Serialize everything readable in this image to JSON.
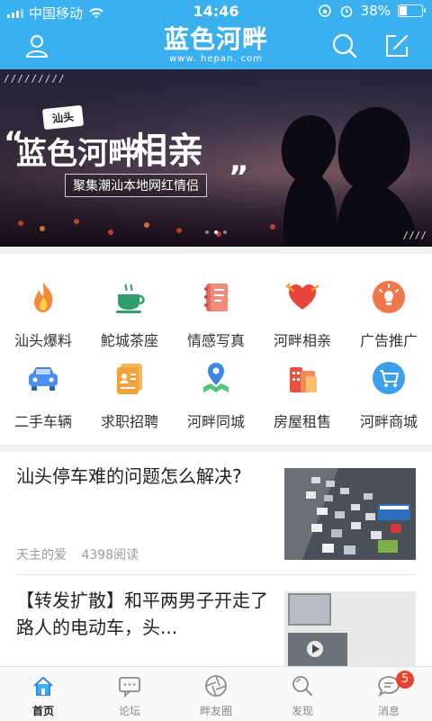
{
  "status_bar": {
    "carrier": "中国移动",
    "time": "14:46",
    "battery": "38%",
    "battery_level": 0.38
  },
  "header": {
    "logo_text": "蓝色河畔",
    "logo_domain": "www. hepan. com"
  },
  "banner": {
    "tag": "汕头",
    "title_part1": "蓝色河畔",
    "title_part2": "相亲",
    "subtitle": "聚集潮汕本地网红情侣",
    "slide_count": 3,
    "active_slide": 1
  },
  "categories": [
    {
      "label": "汕头爆料",
      "icon": "fire-icon",
      "color": "#f6883a"
    },
    {
      "label": "鮀城茶座",
      "icon": "tea-cup-icon",
      "color": "#2e9e6a"
    },
    {
      "label": "情感写真",
      "icon": "notebook-icon",
      "color": "#e8675a"
    },
    {
      "label": "河畔相亲",
      "icon": "heart-icon",
      "color": "#e8443a"
    },
    {
      "label": "广告推广",
      "icon": "lightbulb-icon",
      "color": "#f1774a"
    },
    {
      "label": "二手车辆",
      "icon": "car-icon",
      "color": "#3e7fdf"
    },
    {
      "label": "求职招聘",
      "icon": "id-card-icon",
      "color": "#f2a23a"
    },
    {
      "label": "河畔同城",
      "icon": "map-pin-icon",
      "color": "#3a86e0"
    },
    {
      "label": "房屋租售",
      "icon": "building-icon",
      "color": "#e8523e"
    },
    {
      "label": "河畔商城",
      "icon": "shopping-cart-icon",
      "color": "#3aa0ec"
    }
  ],
  "articles": [
    {
      "title": "汕头停车难的问题怎么解决?",
      "author": "天主的爱",
      "reads": "4398阅读"
    },
    {
      "title": "【转发扩散】和平两男子开走了路人的电动车，头..."
    }
  ],
  "tabs": [
    {
      "label": "首页",
      "icon": "home-icon",
      "active": true
    },
    {
      "label": "论坛",
      "icon": "chat-board-icon",
      "active": false
    },
    {
      "label": "畔友圈",
      "icon": "aperture-icon",
      "active": false
    },
    {
      "label": "发现",
      "icon": "search-icon",
      "active": false
    },
    {
      "label": "消息",
      "icon": "message-icon",
      "active": false,
      "badge": "5"
    }
  ],
  "colors": {
    "brand": "#3ab0ef",
    "badge": "#e8432e"
  }
}
